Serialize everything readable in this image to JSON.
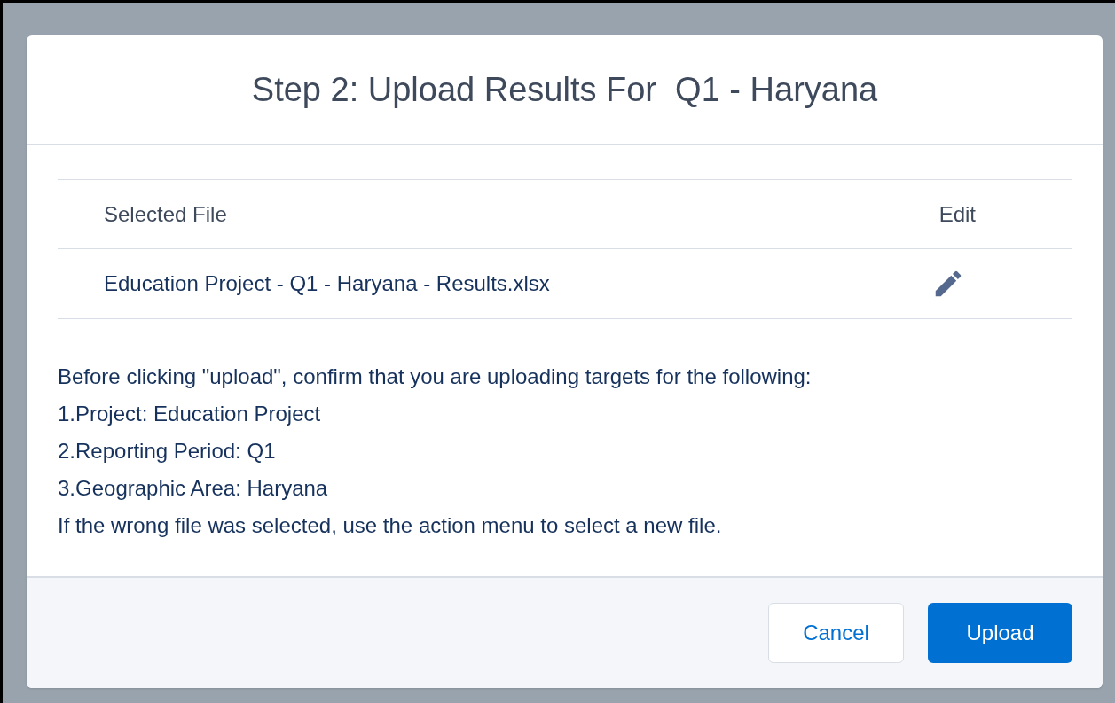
{
  "modal": {
    "title": "Step 2: Upload Results For  Q1 - Haryana"
  },
  "table": {
    "columns": [
      "Selected File",
      "Edit"
    ],
    "rows": [
      {
        "file": "Education Project - Q1 - Haryana - Results.xlsx"
      }
    ]
  },
  "instructions": [
    "Before clicking \"upload\", confirm that you are uploading targets for the following:",
    "1.Project: Education Project",
    "2.Reporting Period: Q1",
    "3.Geographic Area: Haryana",
    "If the wrong file was selected, use the action menu to select a new file."
  ],
  "buttons": [
    {
      "label": "Cancel",
      "kind": "neutral"
    },
    {
      "label": "Upload",
      "kind": "brand"
    }
  ]
}
